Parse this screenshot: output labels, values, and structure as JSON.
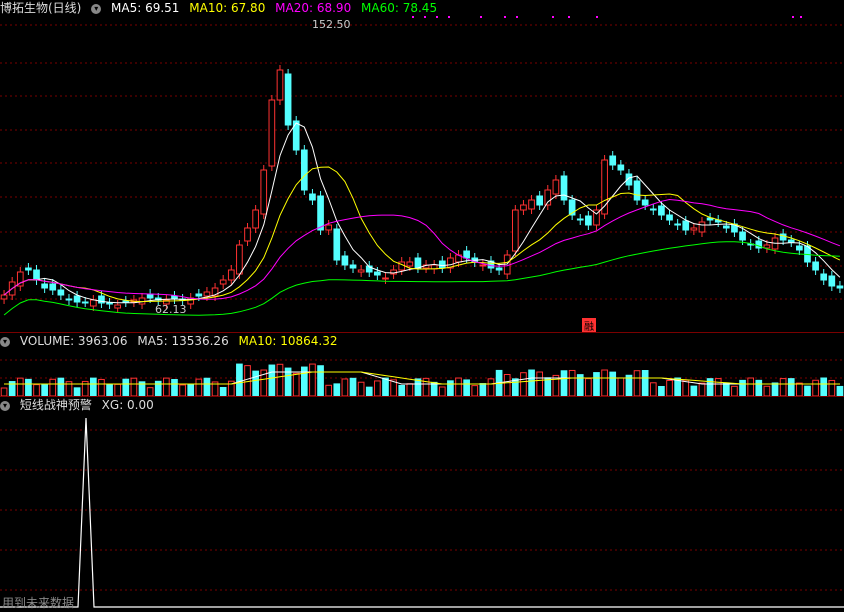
{
  "price": {
    "title": "博拓生物(日线)",
    "ma5": "MA5: 69.51",
    "ma10": "MA10: 67.80",
    "ma20": "MA20: 68.90",
    "ma60": "MA60: 78.45",
    "high_label": "152.50",
    "low_label": "62.13",
    "tag": "融",
    "colors": {
      "up": "#ff3232",
      "down": "#54ffff",
      "ma5": "#ffffff",
      "ma10": "#ffff00",
      "ma20": "#ff00ff",
      "ma60": "#00ff00"
    }
  },
  "volume": {
    "label": "VOLUME: 3963.06",
    "ma5": "MA5: 13536.26",
    "ma10": "MA10: 10864.32"
  },
  "indicator": {
    "name": "短线战神预警",
    "xg": "XG: 0.00",
    "note": "用到未来数据"
  }
}
